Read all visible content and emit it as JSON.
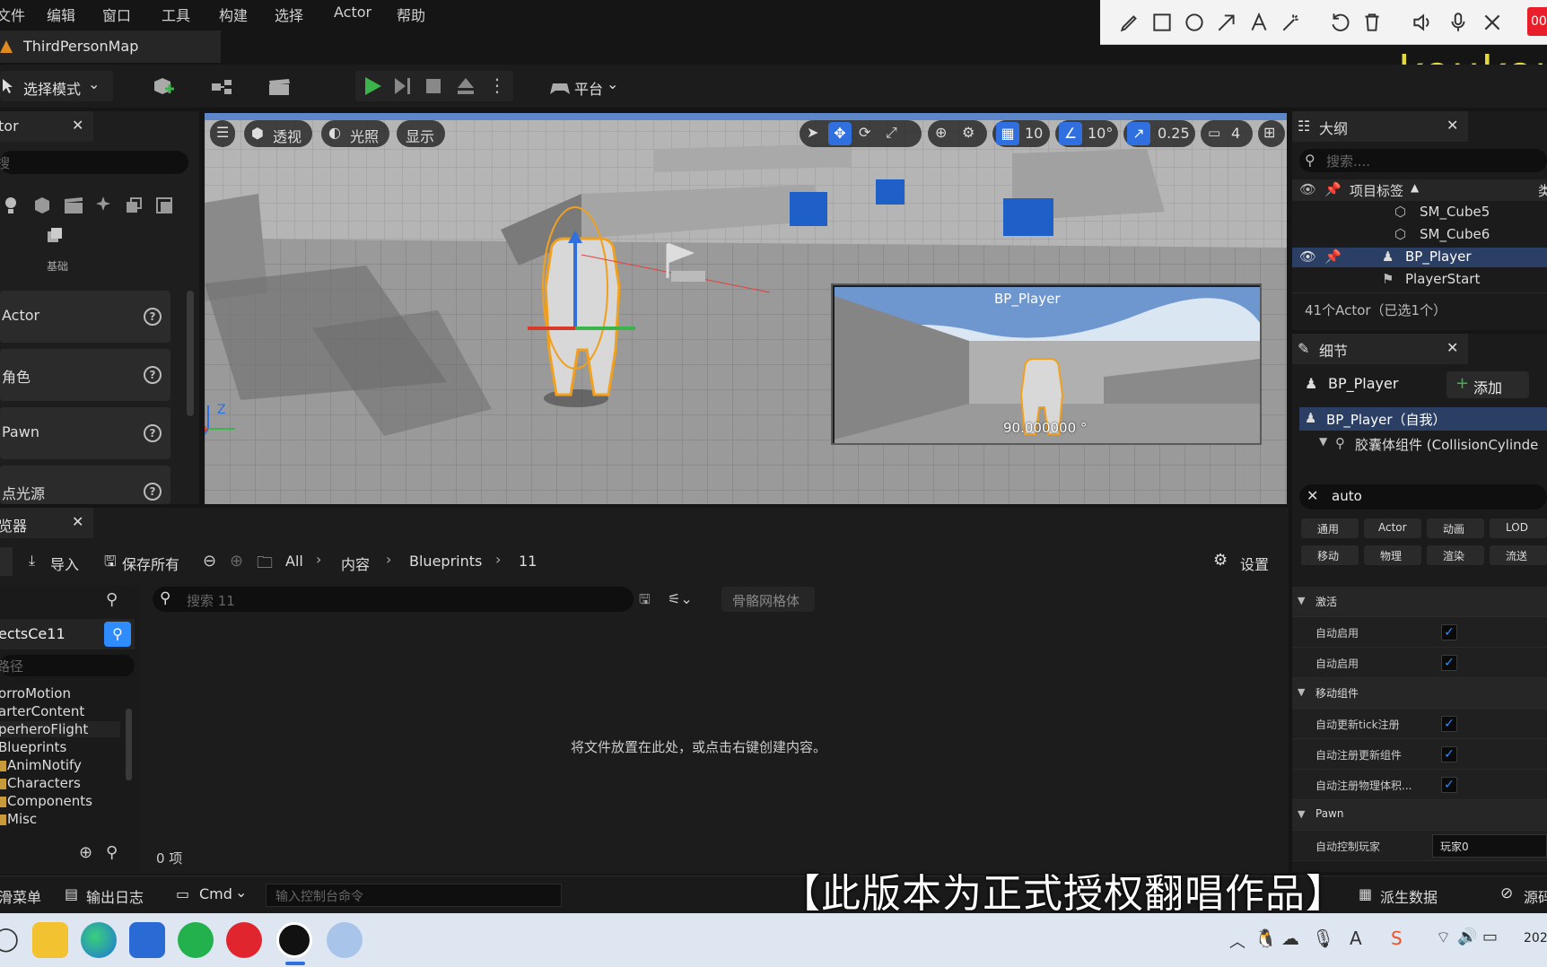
{
  "menu": {
    "items": [
      "文件",
      "编辑",
      "窗口",
      "工具",
      "构建",
      "选择",
      "Actor",
      "帮助"
    ]
  },
  "annotation_toolbar": {
    "tools": [
      "pencil-icon",
      "rectangle-icon",
      "circle-icon",
      "arrow-icon",
      "text-icon",
      "magic-wand-icon",
      "undo-icon",
      "trash-icon",
      "speaker-icon",
      "mic-icon",
      "close-icon"
    ],
    "timer": "00"
  },
  "map_tab": {
    "label": "ThirdPersonMap"
  },
  "watermark": "koukou",
  "toolbar": {
    "select_mode": "选择模式",
    "platform": "平台"
  },
  "left_panel": {
    "title": "tor",
    "search_placeholder": "搜",
    "category_label": "基础",
    "items": [
      {
        "label": "Actor"
      },
      {
        "label": "角色"
      },
      {
        "label": "Pawn"
      },
      {
        "label": "点光源"
      }
    ]
  },
  "viewport": {
    "perspective": "透视",
    "lighting": "光照",
    "show": "显示",
    "grid_snap": "10",
    "rotation_snap": "10°",
    "scale_snap": "0.25",
    "camera_speed": "4",
    "preview_title": "BP_Player",
    "preview_value": "90.000000 °"
  },
  "outliner": {
    "title": "大纲",
    "search_placeholder": "搜索....",
    "column_label": "项目标签",
    "column_type": "类",
    "rows": [
      {
        "label": "SM_Cube5",
        "selected": false
      },
      {
        "label": "SM_Cube6",
        "selected": false
      },
      {
        "label": "BP_Player",
        "selected": true
      },
      {
        "label": "PlayerStart",
        "selected": false
      }
    ],
    "count": "41个Actor（已选1个）"
  },
  "details": {
    "title": "细节",
    "actor_name": "BP_Player",
    "add_label": "添加",
    "self_label": "BP_Player（自我）",
    "component_label": "胶囊体组件 (CollisionCylinde",
    "search_value": "auto",
    "filters_row1": [
      "通用",
      "Actor",
      "动画",
      "LOD"
    ],
    "filters_row2": [
      "移动",
      "物理",
      "渲染",
      "流送"
    ],
    "sections": [
      {
        "title": "激活",
        "rows": [
          {
            "label": "自动启用",
            "checked": true
          },
          {
            "label": "自动启用",
            "checked": true
          }
        ]
      },
      {
        "title": "移动组件",
        "rows": [
          {
            "label": "自动更新tick注册",
            "checked": true
          },
          {
            "label": "自动注册更新组件",
            "checked": true
          },
          {
            "label": "自动注册物理体积...",
            "checked": true
          }
        ]
      },
      {
        "title": "Pawn",
        "rows": [
          {
            "label": "自动控制玩家",
            "value": "玩家0"
          }
        ]
      }
    ]
  },
  "content_browser": {
    "tab": "览器",
    "import": "导入",
    "save_all": "保存所有",
    "breadcrumb": [
      "All",
      "内容",
      "Blueprints",
      "11"
    ],
    "settings": "设置",
    "search_placeholder": "搜索 11",
    "filter_chip": "骨骼网格体",
    "project_name": "ectsCe11",
    "path_placeholder": "路径",
    "folders": [
      "orroMotion",
      "arterContent",
      "perheroFlight",
      "Blueprints",
      "AnimNotify",
      "Characters",
      "Components",
      "Misc"
    ],
    "empty_message": "将文件放置在此处，或点击右键创建内容。",
    "item_count": "0 项"
  },
  "statusbar": {
    "content_drawer": "滑菜单",
    "output_log": "输出日志",
    "cmd": "Cmd",
    "console_placeholder": "输入控制台命令",
    "derived_data": "派生数据",
    "source_control": "源码"
  },
  "subtitle": "【此版本为正式授权翻唱作品】",
  "taskbar": {
    "year": "202"
  },
  "colors": {
    "accent_blue": "#2f8cff",
    "selection": "#2a3f63",
    "play_green": "#3bb54a",
    "watermark": "#e2d83f"
  }
}
